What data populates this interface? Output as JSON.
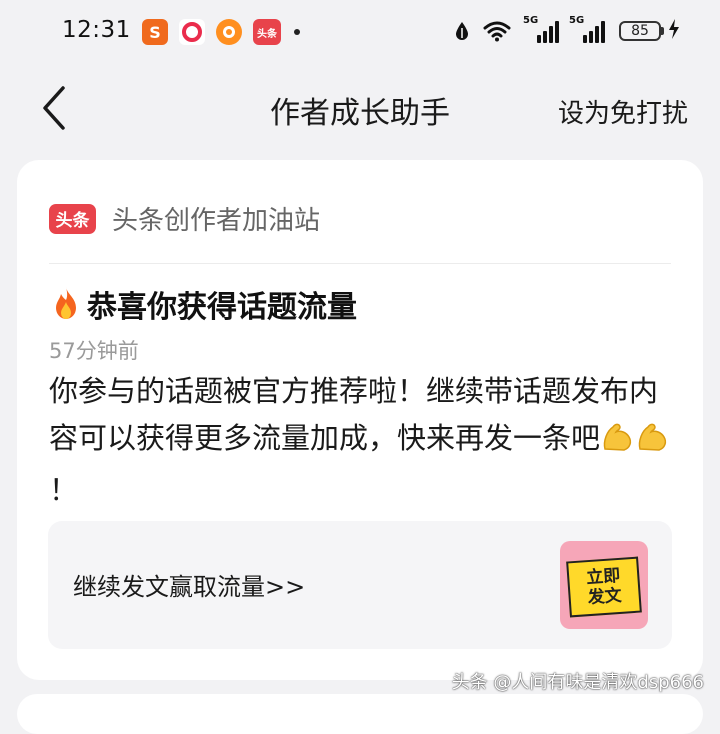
{
  "status_bar": {
    "time": "12:31",
    "apps": [
      "sogou-input-icon",
      "red-app-icon",
      "taobao-icon",
      "toutiao-icon"
    ],
    "toutiao_app_label": "头条",
    "sogou_app_label": "S",
    "signal_1": "5G",
    "signal_2": "5G",
    "battery": "85"
  },
  "nav": {
    "title": "作者成长助手",
    "dnd_label": "设为免打扰"
  },
  "card": {
    "source_logo_text": "头条",
    "source_name": "头条创作者加油站",
    "title": "恭喜你获得话题流量",
    "time": "57分钟前",
    "body_text": "你参与的话题被官方推荐啦！继续带话题发布内容可以获得更多流量加成，快来再发一条吧",
    "body_suffix": "！",
    "cta_label": "继续发文赢取流量>>",
    "cta_thumb_line1": "立即",
    "cta_thumb_line2": "发文"
  },
  "watermark": "头条 @人间有味是清欢dsp666",
  "colors": {
    "background": "#f2f2f4",
    "card": "#ffffff",
    "brand_red": "#e8434b",
    "muted_text": "#9a9a9a"
  }
}
